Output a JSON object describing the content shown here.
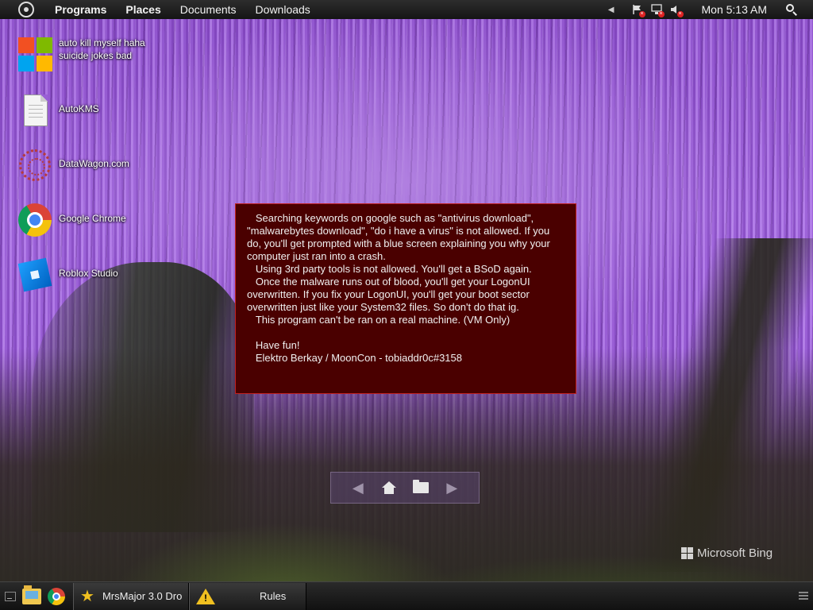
{
  "top_panel": {
    "menu_items": [
      "Programs",
      "Places",
      "Documents",
      "Downloads"
    ],
    "clock": "Mon 5:13 AM"
  },
  "desktop_icons": [
    {
      "label": "auto kill myself haha suicide jokes bad",
      "icon": "windows-logo-icon"
    },
    {
      "label": "AutoKMS",
      "icon": "text-document-icon"
    },
    {
      "label": "DataWagon.com",
      "icon": "web-shortcut-icon"
    },
    {
      "label": "Google Chrome",
      "icon": "chrome-icon"
    },
    {
      "label": "Roblox Studio",
      "icon": "roblox-studio-icon"
    }
  ],
  "message_box": {
    "text": "   Searching keywords on google such as \"antivirus download\", \"malwarebytes download\", \"do i have a virus\" is not allowed. If you do, you'll get prompted with a blue screen explaining you why your computer just ran into a crash.\n   Using 3rd party tools is not allowed. You'll get a BSoD again.\n   Once the malware runs out of blood, you'll get your LogonUI overwritten. If you fix your LogonUI, you'll get your boot sector overwritten just like your System32 files. So don't do that ig.\n   This program can't be ran on a real machine. (VM Only)\n\n   Have fun!\n   Elektro Berkay / MoonCon - tobiaddr0c#3158"
  },
  "dock": {
    "buttons": [
      "back-arrow-icon",
      "home-icon",
      "folder-icon",
      "forward-arrow-icon"
    ]
  },
  "watermark": "Microsoft Bing",
  "taskbar": {
    "tasks": [
      {
        "label": "MrsMajor 3.0 Dro...",
        "icon": "star-icon"
      },
      {
        "label": "Rules",
        "icon": "warning-icon"
      }
    ]
  },
  "colors": {
    "message_bg": "#4a0000",
    "message_border": "#c02020",
    "panel_bg": "#1e1e1e",
    "warning": "#f0c020"
  }
}
